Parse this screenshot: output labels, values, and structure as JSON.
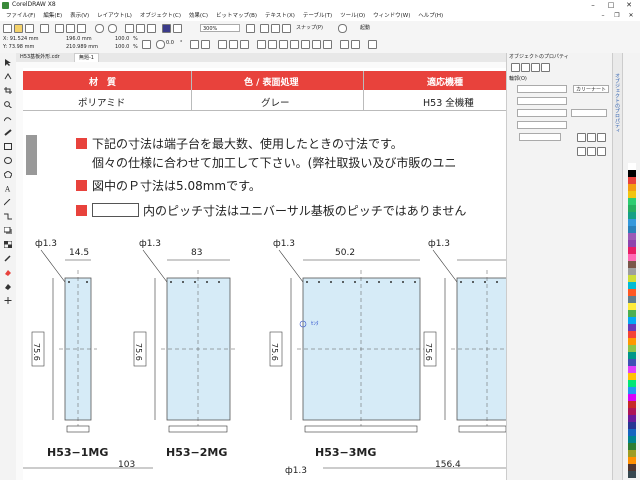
{
  "app": {
    "title": "CorelDRAW X8"
  },
  "menu": [
    "ファイル(F)",
    "編集(E)",
    "表示(V)",
    "レイアウト(L)",
    "オブジェクト(C)",
    "効果(C)",
    "ビットマップ(B)",
    "テキスト(X)",
    "テーブル(T)",
    "ツール(O)",
    "ウィンドウ(W)",
    "ヘルプ(H)"
  ],
  "toolbar": {
    "zoom": "300%",
    "snap": "スナップ(P)",
    "launch": "起動"
  },
  "propbar": {
    "x": "X: 91.524 mm",
    "y": "Y: 73.98 mm",
    "w": "196.0 mm",
    "h": "210.989 mm",
    "sx": "100.0",
    "sy": "100.0",
    "pct": "%",
    "angle": "0.0",
    "angle_unit": "°"
  },
  "tabs": [
    {
      "label": "H53基板外形.cdr"
    },
    {
      "label": "無題-1"
    }
  ],
  "table": {
    "headers": [
      "材　質",
      "色 / 表面処理",
      "適応機種"
    ],
    "row": [
      "ポリアミド",
      "グレー",
      "H53 全機種"
    ]
  },
  "notes": [
    "下記の寸法は端子台を最大数、使用したときの寸法です。",
    "個々の仕様に合わせて加工して下さい。(弊社取扱い及び市販のユニ",
    "図中のＰ寸法は5.08mmです。",
    "内のピッチ寸法はユニバーサル基板のピッチではありません"
  ],
  "drawing": {
    "dims": [
      "ф1.3",
      "14.5",
      "ф1.3",
      "83",
      "ф1.3",
      "50.2",
      "ф1.3",
      "75.6",
      "75.6",
      "75.6",
      "75.6",
      "103",
      "ф1.3",
      "156.4"
    ],
    "models": [
      "H53−1MG",
      "H53−2MG",
      "H53−3MG"
    ],
    "marker": "ｾﾝﾀ"
  },
  "dock": {
    "title": "オブジェクトのプロパティ",
    "section": "輪郭(O)",
    "corner": "カリーナート",
    "tab_label": "オブジェクトのプロパティ"
  },
  "palette": [
    "#ffffff",
    "#000000",
    "#e8423c",
    "#f39c12",
    "#f1c40f",
    "#2ecc71",
    "#27ae60",
    "#16a085",
    "#3498db",
    "#2980b9",
    "#9b59b6",
    "#8e44ad",
    "#e91e63",
    "#ff69b4",
    "#795548",
    "#9e9e9e",
    "#cddc39",
    "#00bcd4",
    "#ff5722",
    "#607d8b",
    "#ffeb3b",
    "#4caf50",
    "#03a9f4",
    "#673ab7",
    "#f44336",
    "#ff9800",
    "#8bc34a",
    "#009688",
    "#3f51b5",
    "#e040fb",
    "#ffc107",
    "#00e676",
    "#2196f3",
    "#d500f9",
    "#c62828",
    "#ad1457",
    "#6a1b9a",
    "#283593",
    "#1565c0",
    "#00838f",
    "#2e7d32",
    "#9e9d24",
    "#ff8f00",
    "#4e342e",
    "#37474f"
  ]
}
